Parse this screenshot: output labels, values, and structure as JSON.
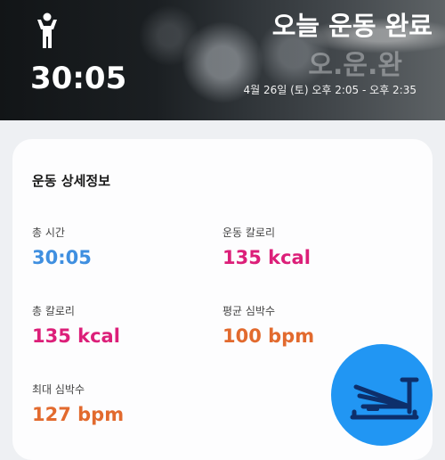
{
  "hero": {
    "duration": "30:05",
    "title": "오늘 운동 완료",
    "ghost_text": "오.운.완",
    "time_range": "4월 26일 (토) 오후 2:05 - 오후 2:35",
    "icon": "exercise-person-icon"
  },
  "details": {
    "title": "운동 상세정보",
    "stats": [
      {
        "label": "총 시간",
        "value": "30:05",
        "color": "#3f8fe0"
      },
      {
        "label": "운동 칼로리",
        "value": "135 kcal",
        "color": "#dc1f79"
      },
      {
        "label": "총 칼로리",
        "value": "135 kcal",
        "color": "#dc1f79"
      },
      {
        "label": "평균 심박수",
        "value": "100 bpm",
        "color": "#e26a2e"
      },
      {
        "label": "최대 심박수",
        "value": "127 bpm",
        "color": "#e26a2e"
      }
    ]
  },
  "fab": {
    "icon": "rowing-machine-icon",
    "color": "#2196f3"
  }
}
